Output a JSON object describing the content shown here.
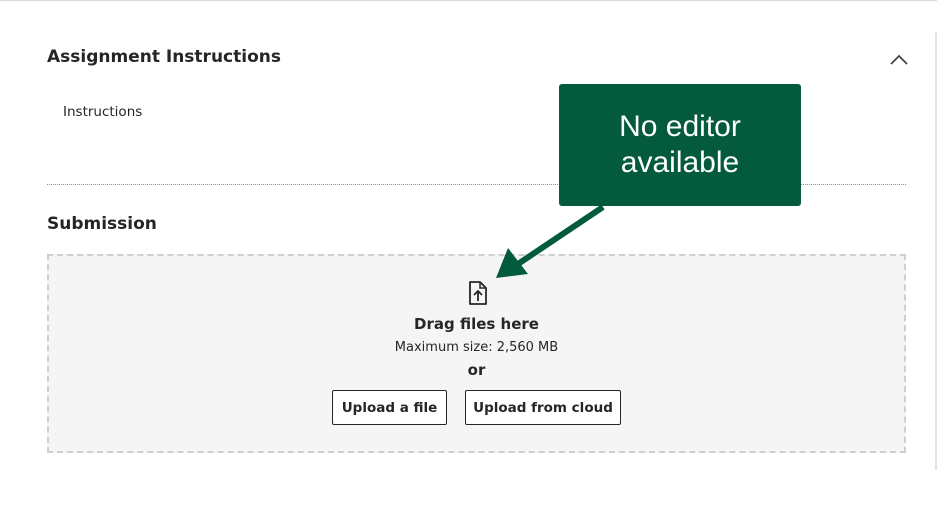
{
  "assignment_instructions": {
    "heading": "Assignment Instructions",
    "body": "Instructions",
    "collapse_icon": "chevron-up-icon"
  },
  "submission": {
    "heading": "Submission",
    "dropzone": {
      "icon": "file-upload-icon",
      "drag_text": "Drag files here",
      "max_size": "Maximum size: 2,560 MB",
      "or_text": "or",
      "upload_file_label": "Upload a file",
      "upload_cloud_label": "Upload from cloud"
    }
  },
  "callout": {
    "text": "No editor available",
    "background": "#035a3c",
    "text_color": "#ffffff"
  }
}
